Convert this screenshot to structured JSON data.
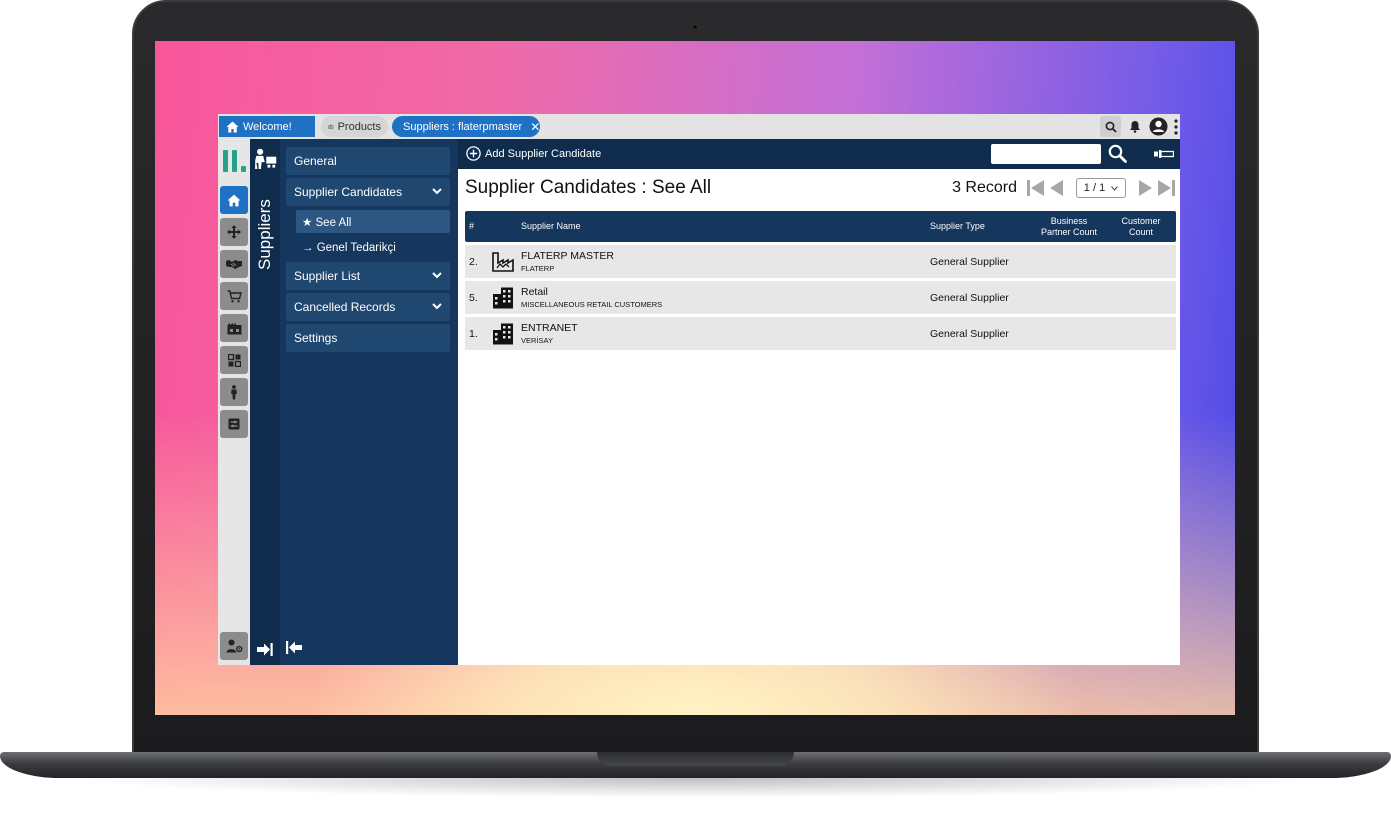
{
  "tabs": [
    {
      "label": "Welcome!"
    },
    {
      "label": "Products"
    },
    {
      "label": "Suppliers : flaterpmaster"
    }
  ],
  "module": {
    "title": "Suppliers"
  },
  "nav": {
    "general": "General",
    "supplier_candidates": "Supplier Candidates",
    "see_all": "★ See All",
    "genel_tedarikci": "→ Genel Tedarikçi",
    "supplier_list": "Supplier List",
    "cancelled_records": "Cancelled Records",
    "settings": "Settings"
  },
  "toolbar": {
    "add_label": "Add Supplier Candidate",
    "search_value": "",
    "search_placeholder": ""
  },
  "page": {
    "title": "Supplier Candidates : See All",
    "record_count": "3 Record",
    "page_selector": "1 / 1"
  },
  "table": {
    "headers": {
      "index": "#",
      "name": "Supplier Name",
      "type": "Supplier Type",
      "bp_count_1": "Business",
      "bp_count_2": "Partner Count",
      "cust_count_1": "Customer",
      "cust_count_2": "Count"
    },
    "rows": [
      {
        "index": "2.",
        "icon": "factory-icon",
        "name": "FLATERP MASTER",
        "sub": "FLATERP",
        "type": "General Supplier",
        "bp_count": "",
        "cust_count": ""
      },
      {
        "index": "5.",
        "icon": "building-icon",
        "name": "Retail",
        "sub": "MISCELLANEOUS RETAIL CUSTOMERS",
        "type": "General Supplier",
        "bp_count": "",
        "cust_count": ""
      },
      {
        "index": "1.",
        "icon": "building-icon",
        "name": "ENTRANET",
        "sub": "VERİSAY",
        "type": "General Supplier",
        "bp_count": "",
        "cust_count": ""
      }
    ]
  },
  "colors": {
    "accent": "#1f71c4",
    "navy": "#0f2c4c",
    "nav_panel": "#15365d",
    "logo_green": "#26a28a"
  }
}
